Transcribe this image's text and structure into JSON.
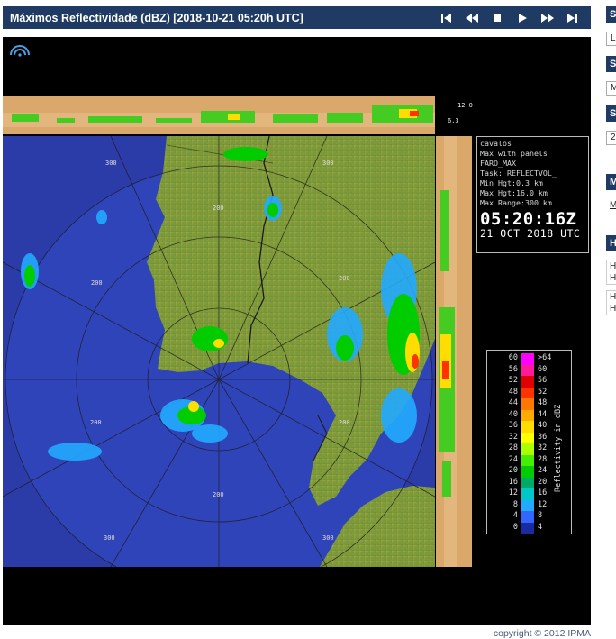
{
  "header": {
    "title": "Máximos Reflectividade (dBZ) [2018-10-21 05:20h UTC]",
    "controls": [
      "first-icon",
      "rewind-icon",
      "stop-icon",
      "play-icon",
      "fast-forward-icon",
      "last-icon"
    ]
  },
  "radar": {
    "range_rings": [
      "200",
      "300",
      "200",
      "300",
      "200",
      "300",
      "200",
      "300",
      "200",
      "200",
      "200"
    ],
    "top_scale": [
      "12.0",
      "6.3"
    ],
    "info": {
      "station": "cavalos",
      "product": "Max with panels",
      "name": "FARO_MAX",
      "task": "Task: REFLECTVOL_",
      "min_hgt": "Min Hgt:0.3 km",
      "max_hgt": "Max Hgt:16.0 km",
      "max_range": "Max Range:300 km",
      "time": "05:20:16Z",
      "date": "21 OCT 2018 UTC"
    },
    "legend": {
      "title": "Reflectivity in dBZ",
      "rows": [
        {
          "left": "60",
          "right": ">64",
          "color": "#ff00ff"
        },
        {
          "left": "56",
          "right": "60",
          "color": "#ff1a9a"
        },
        {
          "left": "52",
          "right": "56",
          "color": "#e00000"
        },
        {
          "left": "48",
          "right": "52",
          "color": "#ff3300"
        },
        {
          "left": "44",
          "right": "48",
          "color": "#ff7700"
        },
        {
          "left": "40",
          "right": "44",
          "color": "#ffaa00"
        },
        {
          "left": "36",
          "right": "40",
          "color": "#ffdd00"
        },
        {
          "left": "32",
          "right": "36",
          "color": "#ffff00"
        },
        {
          "left": "28",
          "right": "32",
          "color": "#aaff00"
        },
        {
          "left": "24",
          "right": "28",
          "color": "#44ee00"
        },
        {
          "left": "20",
          "right": "24",
          "color": "#00cc00"
        },
        {
          "left": "16",
          "right": "20",
          "color": "#00aa66"
        },
        {
          "left": "12",
          "right": "16",
          "color": "#00c8c8"
        },
        {
          "left": "8",
          "right": "12",
          "color": "#22aaff"
        },
        {
          "left": "4",
          "right": "8",
          "color": "#3366ff"
        },
        {
          "left": "0",
          "right": "4",
          "color": "#1a2aa0"
        }
      ]
    }
  },
  "sidebar": {
    "heads": [
      "S",
      "S",
      "S",
      "M",
      "H"
    ],
    "boxes": [
      "L",
      "M",
      "2"
    ],
    "link": "M",
    "list1": [
      "H",
      "H"
    ],
    "list2": [
      "H",
      "H"
    ]
  },
  "footer": {
    "copyright": "copyright © 2012 IPMA"
  },
  "colors": {
    "header_bg": "#1f3b63",
    "radar_blue": "#2b3fae",
    "land": "#7f9a3a"
  }
}
